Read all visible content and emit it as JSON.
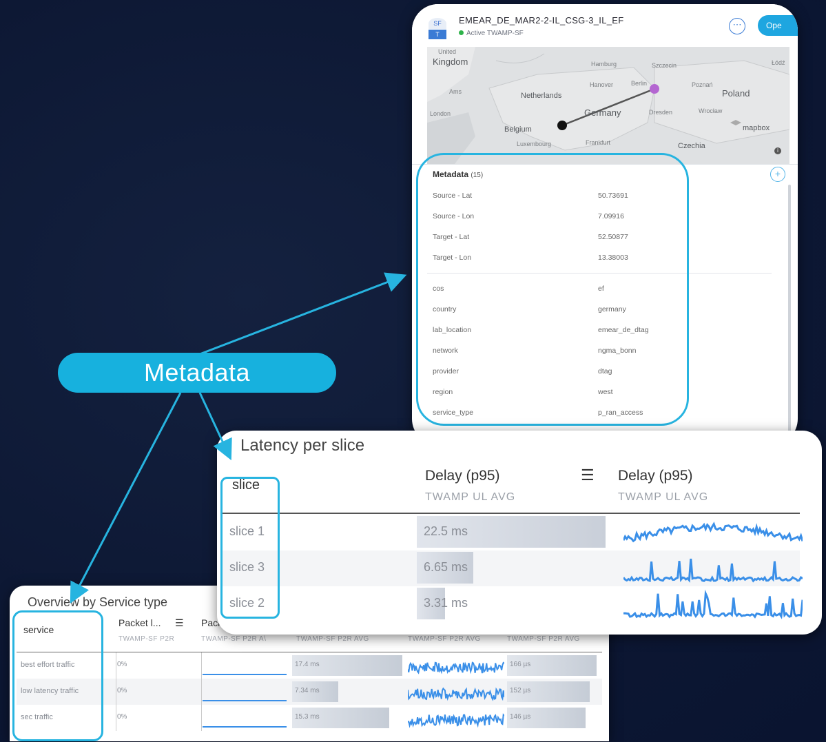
{
  "callout": {
    "label": "Metadata"
  },
  "metadata_panel": {
    "logo_top": "SF",
    "logo_bottom": "T",
    "title": "EMEAR_DE_MAR2-2-IL_CSG-3_IL_EF",
    "status": "Active TWAMP-SF",
    "open_button": "Ope",
    "menu_icon": "more-icon",
    "map_labels": {
      "united": "United",
      "kingdom": "Kingdom",
      "hamburg": "Hamburg",
      "szczecin": "Szczecin",
      "hanover": "Hanover",
      "berlin": "Berlin",
      "poznan": "Poznań",
      "poland": "Poland",
      "ams": "Ams",
      "netherlands": "Netherlands",
      "london": "London",
      "germany": "Germany",
      "dresden": "Dresden",
      "wroclaw": "Wrocław",
      "belgium": "Belgium",
      "luxembourg": "Luxembourg",
      "frankfurt": "Frankfurt",
      "czechia": "Czechia",
      "mapbox": "mapbox",
      "lodz": "Łódź"
    },
    "metadata_heading": "Metadata",
    "metadata_count": "(15)",
    "coords": [
      {
        "key": "Source - Lat",
        "value": "50.73691"
      },
      {
        "key": "Source - Lon",
        "value": "7.09916"
      },
      {
        "key": "Target - Lat",
        "value": "52.50877"
      },
      {
        "key": "Target - Lon",
        "value": "13.38003"
      }
    ],
    "attributes": [
      {
        "key": "cos",
        "value": "ef"
      },
      {
        "key": "country",
        "value": "germany"
      },
      {
        "key": "lab_location",
        "value": "emear_de_dtag"
      },
      {
        "key": "network",
        "value": "ngma_bonn"
      },
      {
        "key": "provider",
        "value": "dtag"
      },
      {
        "key": "region",
        "value": "west"
      },
      {
        "key": "service_type",
        "value": "p_ran_access"
      }
    ]
  },
  "latency_panel": {
    "title": "Latency per slice",
    "col_slice": "slice",
    "col_delay1": "Delay (p95)",
    "col_delay1_sub": "TWAMP UL AVG",
    "col_delay2": "Delay (p95)",
    "col_delay2_sub": "TWAMP UL AVG",
    "rows": [
      {
        "slice": "slice 1",
        "delay": "22.5 ms",
        "fraction": 1.0
      },
      {
        "slice": "slice 3",
        "delay": "6.65 ms",
        "fraction": 0.3
      },
      {
        "slice": "slice 2",
        "delay": "3.31 ms",
        "fraction": 0.15
      }
    ]
  },
  "overview_panel": {
    "title": "Overview by Service type",
    "col_service": "service",
    "col_packet1": "Packet l...",
    "col_packet2": "Pack",
    "sub_labels": [
      "TWAMP-SF P2R",
      "TWAMP-SF P2R A\\",
      "TWAMP-SF P2R AVG",
      "TWAMP-SF P2R AVG",
      "TWAMP-SF P2R AVG"
    ],
    "rows": [
      {
        "service": "best effort traffic",
        "loss": "0%",
        "delay": "17.4 ms",
        "delay_fraction": 1.0,
        "jitter": "166 µs",
        "jitter_fraction": 1.0
      },
      {
        "service": "low latency traffic",
        "loss": "0%",
        "delay": "7.34 ms",
        "delay_fraction": 0.42,
        "jitter": "152 µs",
        "jitter_fraction": 0.92
      },
      {
        "service": "sec traffic",
        "loss": "0%",
        "delay": "15.3 ms",
        "delay_fraction": 0.88,
        "jitter": "146 µs",
        "jitter_fraction": 0.88
      }
    ]
  },
  "colors": {
    "accent": "#27b4e0",
    "spark": "#3a8fe8",
    "background": "#0d1834"
  }
}
